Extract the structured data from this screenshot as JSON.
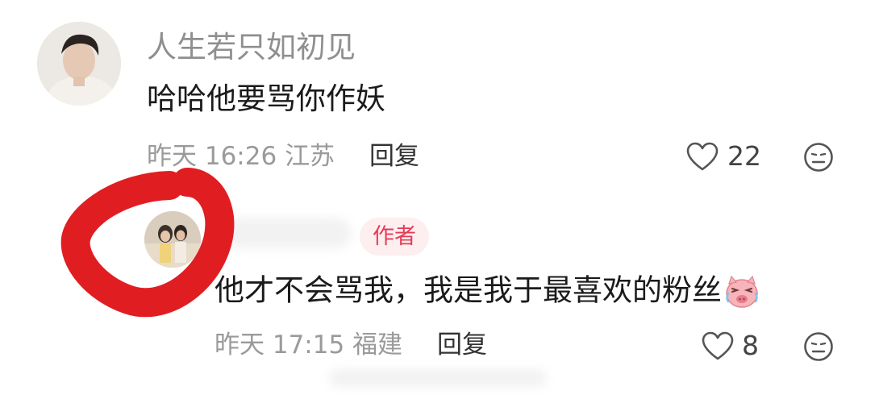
{
  "comments": [
    {
      "username": "人生若只如初见",
      "text": "哈哈他要骂你作妖",
      "time": "昨天 16:26",
      "location": "江苏",
      "reply_label": "回复",
      "like_count": "22"
    },
    {
      "username": "",
      "badge": "作者",
      "text": "他才不会骂我，我是我于最喜欢的粉丝",
      "time": "昨天 17:15",
      "location": "福建",
      "reply_label": "回复",
      "like_count": "8"
    }
  ],
  "icons": {
    "like": "heart-outline-icon",
    "dislike": "sad-face-icon",
    "emoji": "crying-pig-emoji"
  },
  "colors": {
    "author_badge_text": "#e53c56",
    "author_badge_bg": "#fdeef0",
    "annotation_red": "#e01e22",
    "meta_gray": "#9a9a9a"
  }
}
